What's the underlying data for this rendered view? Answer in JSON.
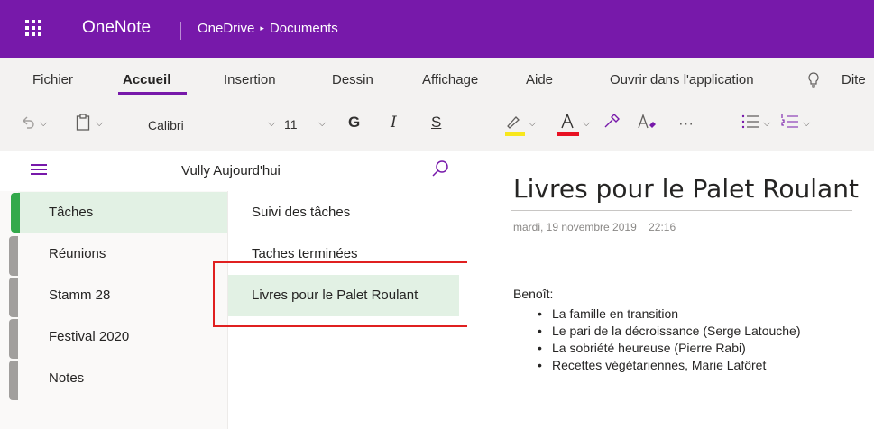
{
  "titlebar": {
    "app_name": "OneNote",
    "breadcrumb": [
      "OneDrive",
      "Documents"
    ],
    "breadcrumb_sep": "▸"
  },
  "menu": {
    "items": [
      "Fichier",
      "Accueil",
      "Insertion",
      "Dessin",
      "Affichage",
      "Aide",
      "Ouvrir dans l'application",
      "Dite"
    ],
    "active": "Accueil"
  },
  "toolbar": {
    "font_name": "Calibri",
    "font_size": "11",
    "bold": "G",
    "italic": "I",
    "underline": "S",
    "more": "···"
  },
  "nav": {
    "notebook_name": "Vully Aujourd'hui",
    "sections": [
      "Tâches",
      "Réunions",
      "Stamm 28",
      "Festival 2020",
      "Notes"
    ],
    "selected_section": "Tâches",
    "pages": [
      "Suivi des tâches",
      "Taches terminées",
      "Livres pour le Palet Roulant"
    ],
    "selected_page": "Livres pour le Palet Roulant"
  },
  "content": {
    "title": "Livres pour le Palet Roulant",
    "date": "mardi, 19 novembre 2019",
    "time": "22:16",
    "author": "Benoît:",
    "bullets": [
      "La famille en transition",
      "Le pari de la décroissance (Serge Latouche)",
      "La sobriété heureuse (Pierre Rabi)",
      "Recettes végétariennes,  Marie Lafôret"
    ]
  },
  "colors": {
    "brand": "#7719aa",
    "section_green": "#33a94b",
    "selected_bg": "#e2f1e4",
    "highlight_red": "#e02020"
  }
}
